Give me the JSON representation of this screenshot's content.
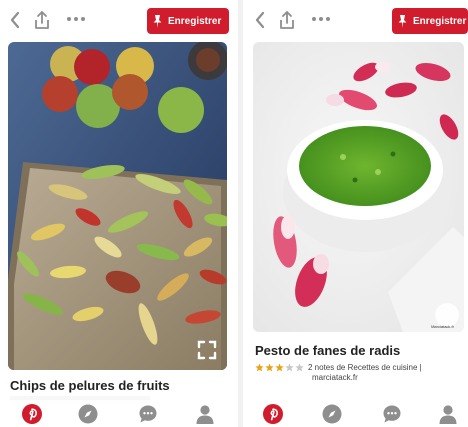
{
  "left_pin": {
    "save_label": "Enregistrer",
    "title": "Chips de pelures de fruits"
  },
  "right_pin": {
    "save_label": "Enregistrer",
    "title": "Pesto de fanes de radis",
    "rating_stars": 3,
    "rating_max": 5,
    "rating_text": "2 notes de Recettes de cuisine |",
    "source": "marciatack.fr",
    "watermark": "Marciatack.fr"
  },
  "colors": {
    "pinterest_red": "#d01c2c",
    "icon_gray": "#8e8e8e",
    "star_gold": "#e8a317",
    "star_empty": "#c7c7c7"
  },
  "icons": {
    "top": [
      "back-arrow-icon",
      "share-icon",
      "more-icon",
      "pin-icon"
    ],
    "nav": [
      "pinterest-home-icon",
      "explore-compass-icon",
      "messages-icon",
      "profile-icon"
    ]
  }
}
